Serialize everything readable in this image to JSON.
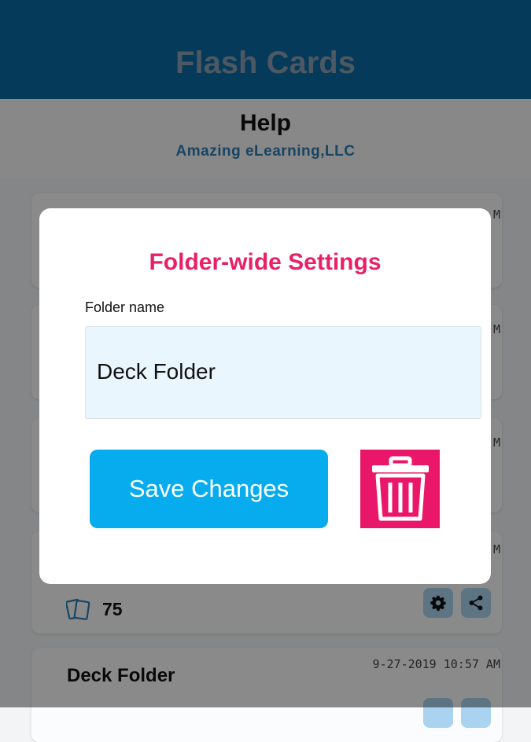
{
  "app": {
    "title": "Flash Cards"
  },
  "help": {
    "title": "Help",
    "subtitle": "Amazing eLearning,LLC"
  },
  "cards": [
    {
      "count": "75"
    },
    {
      "title": "Deck Folder",
      "date": "9-27-2019 10:57 AM"
    }
  ],
  "partial_dates": [
    "M",
    "M",
    "M",
    "M",
    "M"
  ],
  "modal": {
    "title": "Folder-wide Settings",
    "field_label": "Folder name",
    "field_value": "Deck Folder",
    "save_label": "Save Changes"
  },
  "icons": {
    "count": "cards-icon",
    "settings": "gear-icon",
    "share": "share-icon",
    "delete": "trash-icon"
  },
  "colors": {
    "header": "#0a6aa4",
    "modal_title": "#ea1f68",
    "save": "#07acef",
    "delete": "#e9166a"
  }
}
